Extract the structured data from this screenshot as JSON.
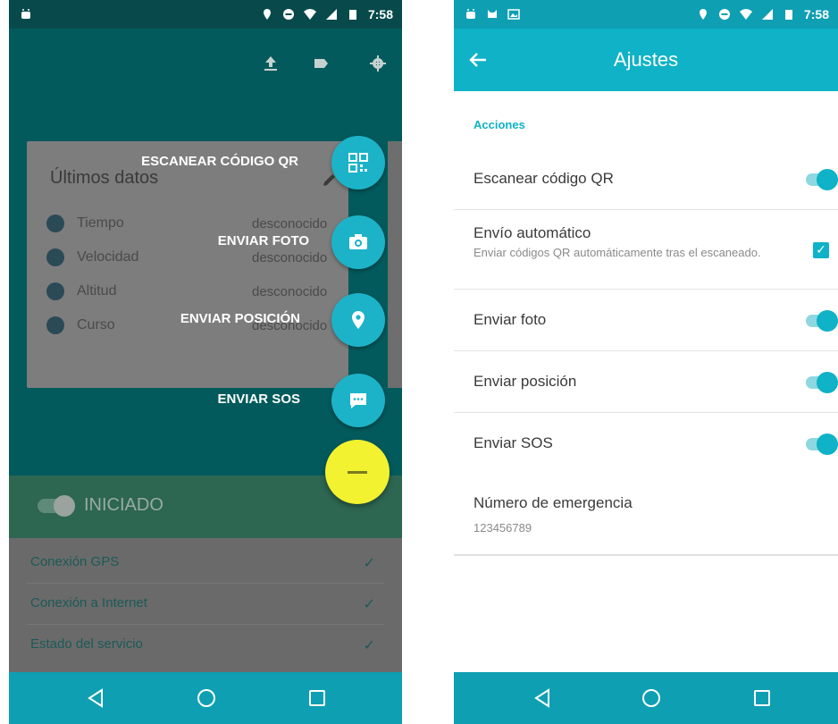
{
  "colors": {
    "teal_accent": "#0fb2c6",
    "dark_teal_bg": "#025a5c",
    "yellow_fab": "#f2f230",
    "navbar": "#0e9fb3"
  },
  "left": {
    "status": {
      "time": "7:58"
    },
    "card": {
      "title": "Últimos datos",
      "rows": [
        {
          "label": "Tiempo",
          "value": "desconocido",
          "icon": "clock-icon"
        },
        {
          "label": "Velocidad",
          "value": "desconocido",
          "icon": "speed-icon"
        },
        {
          "label": "Altitud",
          "value": "desconocido",
          "icon": "mountain-icon"
        },
        {
          "label": "Curso",
          "value": "desconocido",
          "icon": "compass-icon"
        }
      ]
    },
    "fab_actions": [
      {
        "label": "ESCANEAR CÓDIGO QR",
        "icon": "qr-code-icon"
      },
      {
        "label": "ENVIAR FOTO",
        "icon": "camera-icon"
      },
      {
        "label": "ENVIAR POSICIÓN",
        "icon": "location-pin-icon"
      },
      {
        "label": "ENVIAR SOS",
        "icon": "chat-bubble-icon"
      }
    ],
    "service_label": "INICIADO",
    "status_list": [
      {
        "label": "Conexión GPS"
      },
      {
        "label": "Conexión a Internet"
      },
      {
        "label": "Estado del servicio"
      }
    ]
  },
  "right": {
    "status": {
      "time": "7:58"
    },
    "title": "Ajustes",
    "section": "Acciones",
    "settings": [
      {
        "title": "Escanear código QR",
        "control": "toggle",
        "on": true
      },
      {
        "title": "Envío automático",
        "subtitle": "Enviar códigos QR automáticamente tras el escaneado.",
        "control": "checkbox",
        "checked": true
      },
      {
        "title": "Enviar foto",
        "control": "toggle",
        "on": true
      },
      {
        "title": "Enviar posición",
        "control": "toggle",
        "on": true
      },
      {
        "title": "Enviar SOS",
        "control": "toggle",
        "on": true
      },
      {
        "title": "Número de emergencia",
        "subtitle": "123456789",
        "control": "none"
      }
    ]
  }
}
